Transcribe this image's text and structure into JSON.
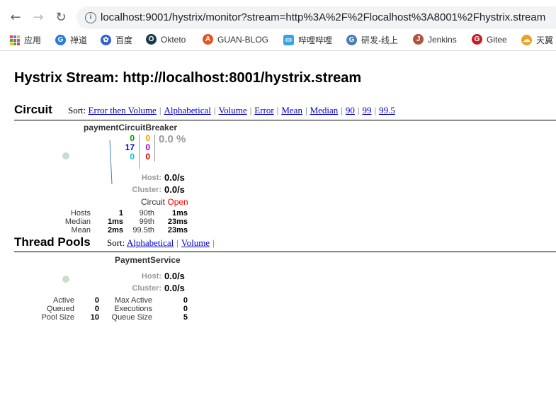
{
  "browser": {
    "url": "localhost:9001/hystrix/monitor?stream=http%3A%2F%2Flocalhost%3A8001%2Fhystrix.stream",
    "bookmarks": [
      {
        "label": "应用",
        "icon": "apps-grid-icon",
        "color": "#4285f4"
      },
      {
        "label": "禅道",
        "icon": "zentao-icon",
        "color": "#2a7bd4"
      },
      {
        "label": "百度",
        "icon": "baidu-paw-icon",
        "color": "#3060d0"
      },
      {
        "label": "Okteto",
        "icon": "okteto-icon",
        "color": "#1a3b4a"
      },
      {
        "label": "GUAN-BLOG",
        "icon": "guan-blog-icon",
        "color": "#e8541e"
      },
      {
        "label": "哔哩哔哩",
        "icon": "bilibili-icon",
        "color": "#3aa3e0"
      },
      {
        "label": "研发-线上",
        "icon": "dev-online-icon",
        "color": "#4a7ab8"
      },
      {
        "label": "Jenkins",
        "icon": "jenkins-icon",
        "color": "#b5523b"
      },
      {
        "label": "Gitee",
        "icon": "gitee-icon",
        "color": "#c71d23"
      },
      {
        "label": "天翼",
        "icon": "cloud-icon",
        "color": "#f0a020"
      }
    ]
  },
  "page": {
    "title": "Hystrix Stream: http://localhost:8001/hystrix.stream"
  },
  "circuit": {
    "title": "Circuit",
    "sort_label": "Sort:",
    "sort_links": [
      "Error then Volume",
      "Alphabetical",
      "Volume",
      "Error",
      "Mean",
      "Median",
      "90",
      "99",
      "99.5"
    ],
    "name": "paymentCircuitBreaker",
    "counts": {
      "success": "0",
      "short_circuited": "17",
      "bad_request": "0",
      "timeout": "0",
      "rejected": "0",
      "failure": "0"
    },
    "colors": {
      "success": "#009900",
      "short_circuited": "#0000ff",
      "bad_request": "#00cccc",
      "timeout": "#ff9900",
      "rejected": "#9900cc",
      "failure": "#cc0000"
    },
    "error_pct": "0.0 %",
    "host_label": "Host:",
    "host_rate": "0.0/s",
    "cluster_label": "Cluster:",
    "cluster_rate": "0.0/s",
    "circuit_label": "Circuit",
    "circuit_status": "Open",
    "stats": {
      "hosts_label": "Hosts",
      "hosts": "1",
      "median_label": "Median",
      "median": "1ms",
      "mean_label": "Mean",
      "mean": "2ms",
      "p90_label": "90th",
      "p90": "1ms",
      "p99_label": "99th",
      "p99": "23ms",
      "p995_label": "99.5th",
      "p995": "23ms"
    }
  },
  "thread_pools": {
    "title": "Thread Pools",
    "sort_label": "Sort:",
    "sort_links": [
      "Alphabetical",
      "Volume"
    ],
    "name": "PaymentService",
    "host_label": "Host:",
    "host_rate": "0.0/s",
    "cluster_label": "Cluster:",
    "cluster_rate": "0.0/s",
    "stats": {
      "active_label": "Active",
      "active": "0",
      "queued_label": "Queued",
      "queued": "0",
      "pool_size_label": "Pool Size",
      "pool_size": "10",
      "max_active_label": "Max Active",
      "max_active": "0",
      "executions_label": "Executions",
      "executions": "0",
      "queue_size_label": "Queue Size",
      "queue_size": "5"
    }
  }
}
